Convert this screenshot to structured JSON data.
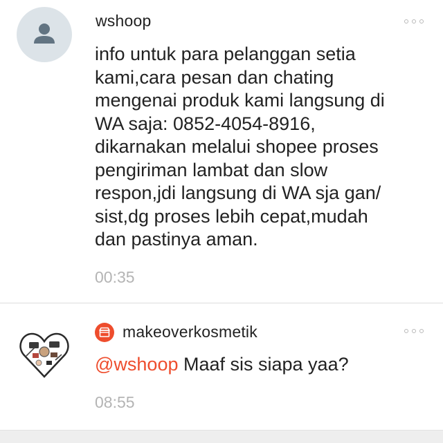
{
  "comments": [
    {
      "username": "wshoop",
      "text": "info untuk para pelanggan setia\nkami,cara pesan dan chating\nmengenai produk kami langsung di\nWA saja: 0852-4054-8916,\ndikarnakan melalui shopee proses\npengiriman lambat dan slow\nrespon,jdi  langsung di WA sja gan/\nsist,dg proses lebih cepat,mudah\ndan pastinya aman.",
      "time": "00:35",
      "avatar_icon": "default-user-icon"
    },
    {
      "username": "makeoverkosmetik",
      "mention": "@wshoop",
      "text": " Maaf sis siapa yaa?",
      "time": "08:55",
      "avatar_icon": "cosmetics-heart-avatar",
      "badge_icon": "shop-icon"
    }
  ],
  "colors": {
    "accent": "#ee4d2d",
    "timestamp": "#b4b4b4",
    "avatar_bg": "#dce3e8",
    "avatar_fg": "#627482"
  }
}
